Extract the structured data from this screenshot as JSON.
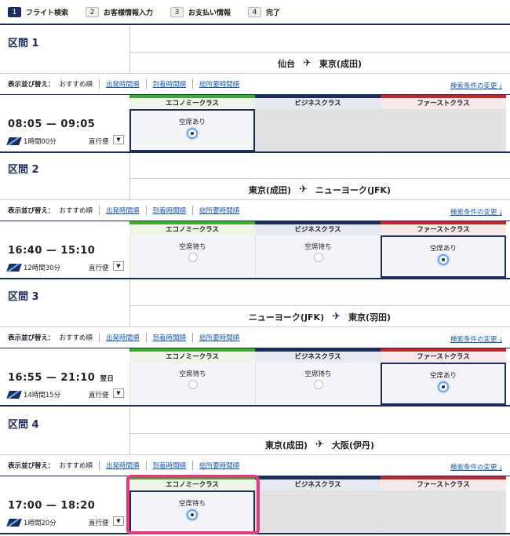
{
  "steps": [
    {
      "num": "1",
      "label": "フライト検索"
    },
    {
      "num": "2",
      "label": "お客様情報入力"
    },
    {
      "num": "3",
      "label": "お支払い情報"
    },
    {
      "num": "4",
      "label": "完了"
    }
  ],
  "sort": {
    "label": "表示並び替え：",
    "current": "おすすめ順",
    "links": [
      "出発時間順",
      "到着時間順",
      "総所要時間順"
    ],
    "change_conditions": "検索条件の変更"
  },
  "classes": {
    "economy": "エコノミークラス",
    "business": "ビジネスクラス",
    "first": "ファーストクラス"
  },
  "segments": [
    {
      "title": "区間 1",
      "from": "仙台",
      "to": "東京(成田)",
      "times": "08:05 — 09:05",
      "next_day": "",
      "duration": "1時間00分",
      "direct": "直行便",
      "economy": "空席あり",
      "business": "",
      "first": ""
    },
    {
      "title": "区間 2",
      "from": "東京(成田)",
      "to": "ニューヨーク(JFK)",
      "times": "16:40 — 15:10",
      "next_day": "",
      "duration": "12時間30分",
      "direct": "直行便",
      "economy": "空席待ち",
      "business": "空席待ち",
      "first": "空席あり"
    },
    {
      "title": "区間 3",
      "from": "ニューヨーク(JFK)",
      "to": "東京(羽田)",
      "times": "16:55 — 21:10",
      "next_day": "翌日",
      "duration": "14時間15分",
      "direct": "直行便",
      "economy": "空席待ち",
      "business": "空席待ち",
      "first": "空席あり"
    },
    {
      "title": "区間 4",
      "from": "東京(成田)",
      "to": "大阪(伊丹)",
      "times": "17:00 — 18:20",
      "next_day": "",
      "duration": "1時間20分",
      "direct": "直行便",
      "economy": "空席待ち",
      "business": "",
      "first": ""
    }
  ],
  "colors": {
    "navy": "#1c2d5c",
    "economy": "#3dae2b",
    "first": "#c1272d",
    "highlight": "#e8397a"
  }
}
